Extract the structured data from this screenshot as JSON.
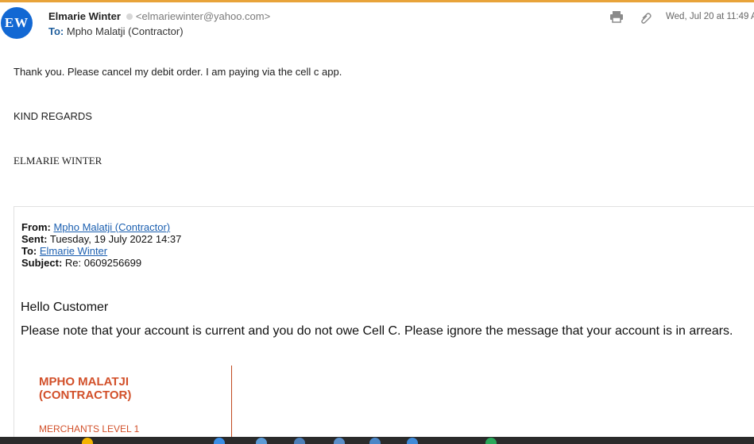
{
  "header": {
    "avatar_initials": "EW",
    "sender_name": "Elmarie Winter",
    "sender_email": "<elmariewinter@yahoo.com>",
    "to_label": "To:",
    "to_value": "Mpho Malatji (Contractor)",
    "date": "Wed, Jul 20 at 11:49 A",
    "icons": [
      "print-icon",
      "attachment-icon"
    ]
  },
  "message": {
    "line1": "Thank you. Please cancel my debit order. I am paying via the cell c app.",
    "regards": "KIND REGARDS",
    "signature": "ELMARIE WINTER"
  },
  "quoted": {
    "from_label": "From:",
    "from_value": "Mpho Malatji (Contractor)",
    "sent_label": "Sent:",
    "sent_value": "Tuesday, 19 July 2022 14:37",
    "to_label": "To:",
    "to_value": "Elmarie Winter",
    "subject_label": "Subject:",
    "subject_value": "Re: 0609256699",
    "greeting": "Hello Customer",
    "note": "Please note that your account is current and you do not owe  Cell C. Please ignore the message that your account is in arrears.",
    "sig_name_line1": "MPHO MALATJI",
    "sig_name_line2": "(CONTRACTOR)",
    "sig_title": "MERCHANTS LEVEL 1"
  },
  "colors": {
    "accent": "#e8a33a",
    "avatar": "#1268d3",
    "signature": "#d2502a",
    "link": "#1b5fb0"
  }
}
